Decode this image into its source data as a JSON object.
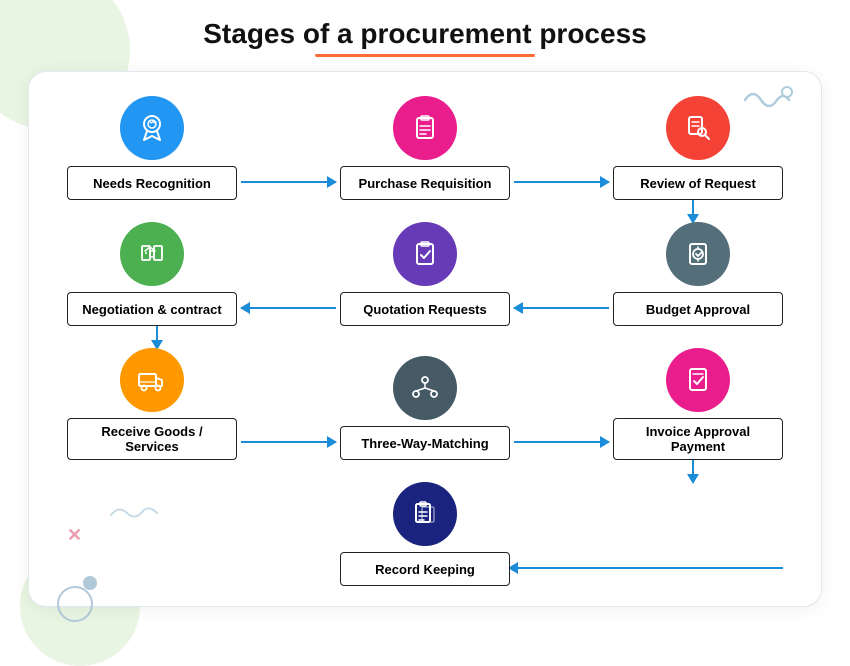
{
  "title": "Stages of a procurement process",
  "nodes": {
    "needs_recognition": {
      "label": "Needs Recognition",
      "icon": "award",
      "color": "ic-blue"
    },
    "purchase_requisition": {
      "label": "Purchase Requisition",
      "icon": "clipboard-list",
      "color": "ic-pink"
    },
    "review_of_request": {
      "label": "Review of Request",
      "icon": "search-doc",
      "color": "ic-red"
    },
    "negotiation_contract": {
      "label": "Negotiation & contract",
      "icon": "handshake",
      "color": "ic-green"
    },
    "quotation_requests": {
      "label": "Quotation Requests",
      "icon": "clipboard-check",
      "color": "ic-purple"
    },
    "budget_approval": {
      "label": "Budget Approval",
      "icon": "dollar-check",
      "color": "ic-darkgray"
    },
    "receive_goods": {
      "label": "Receive Goods / Services",
      "icon": "truck",
      "color": "ic-orange"
    },
    "three_way_matching": {
      "label": "Three-Way-Matching",
      "icon": "network",
      "color": "ic-teal"
    },
    "invoice_approval": {
      "label": "Invoice Approval Payment",
      "icon": "invoice-check",
      "color": "ic-magenta"
    },
    "record_keeping": {
      "label": "Record Keeping",
      "icon": "records",
      "color": "ic-navy"
    }
  }
}
